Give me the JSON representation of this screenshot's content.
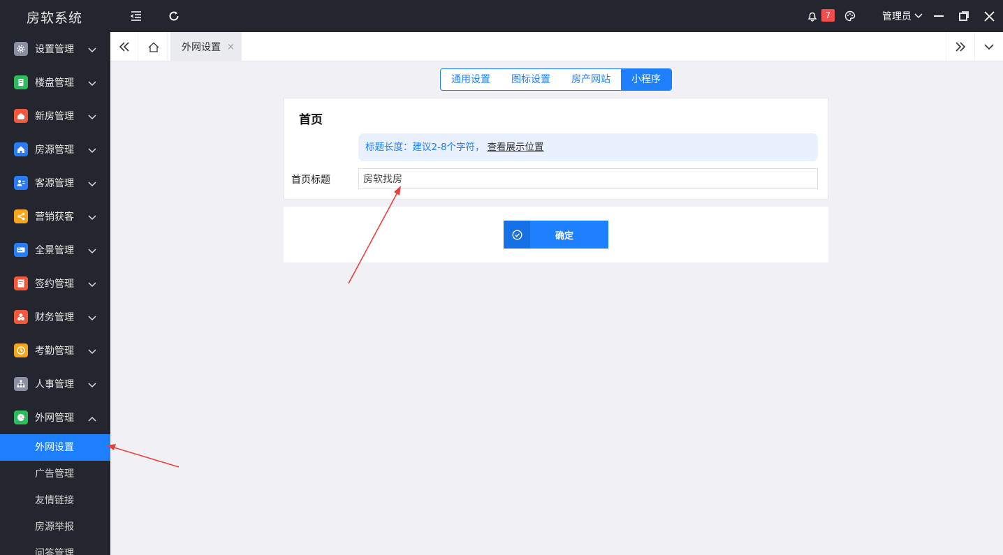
{
  "app": {
    "title": "房软系统"
  },
  "topbar": {
    "notification_count": "7",
    "user": "管理员"
  },
  "sidebar": {
    "items": [
      {
        "label": "设置管理",
        "icon": "gear-icon",
        "color": "#8a8fa3",
        "expanded": false
      },
      {
        "label": "楼盘管理",
        "icon": "building-icon",
        "color": "#2dbb5d",
        "expanded": false
      },
      {
        "label": "新房管理",
        "icon": "house-new-icon",
        "color": "#f4583a",
        "expanded": false
      },
      {
        "label": "房源管理",
        "icon": "home-icon",
        "color": "#2a7bf6",
        "expanded": false
      },
      {
        "label": "客源管理",
        "icon": "contacts-icon",
        "color": "#2a7bf6",
        "expanded": false
      },
      {
        "label": "营销获客",
        "icon": "share-icon",
        "color": "#f7a51c",
        "expanded": false
      },
      {
        "label": "全景管理",
        "icon": "panorama-icon",
        "color": "#2a7bf6",
        "expanded": false
      },
      {
        "label": "签约管理",
        "icon": "contract-icon",
        "color": "#f4583a",
        "expanded": false
      },
      {
        "label": "财务管理",
        "icon": "finance-icon",
        "color": "#f4583a",
        "expanded": false
      },
      {
        "label": "考勤管理",
        "icon": "clock-icon",
        "color": "#f7a51c",
        "expanded": false
      },
      {
        "label": "人事管理",
        "icon": "org-chart-icon",
        "color": "#8a8fa3",
        "expanded": false
      },
      {
        "label": "外网管理",
        "icon": "web-icon",
        "color": "#2dbb5d",
        "expanded": true
      }
    ],
    "subitems": [
      {
        "label": "外网设置",
        "active": true
      },
      {
        "label": "广告管理",
        "active": false
      },
      {
        "label": "友情链接",
        "active": false
      },
      {
        "label": "房源举报",
        "active": false
      },
      {
        "label": "问答管理",
        "active": false
      }
    ]
  },
  "tabs": {
    "open_tab": "外网设置",
    "close_symbol": "×"
  },
  "settings_tabs": [
    {
      "label": "通用设置",
      "active": false
    },
    {
      "label": "图标设置",
      "active": false
    },
    {
      "label": "房产网站",
      "active": false
    },
    {
      "label": "小程序",
      "active": true
    }
  ],
  "form": {
    "section_title": "首页",
    "tip_text": "标题长度：建议2-8个字符，",
    "tip_link": "查看展示位置",
    "field_label": "首页标题",
    "field_value": "房软找房",
    "confirm_label": "确定"
  },
  "colors": {
    "accent": "#1e80ff",
    "sidebar_bg": "#23262e",
    "annotation_arrow": "#e8403a"
  }
}
